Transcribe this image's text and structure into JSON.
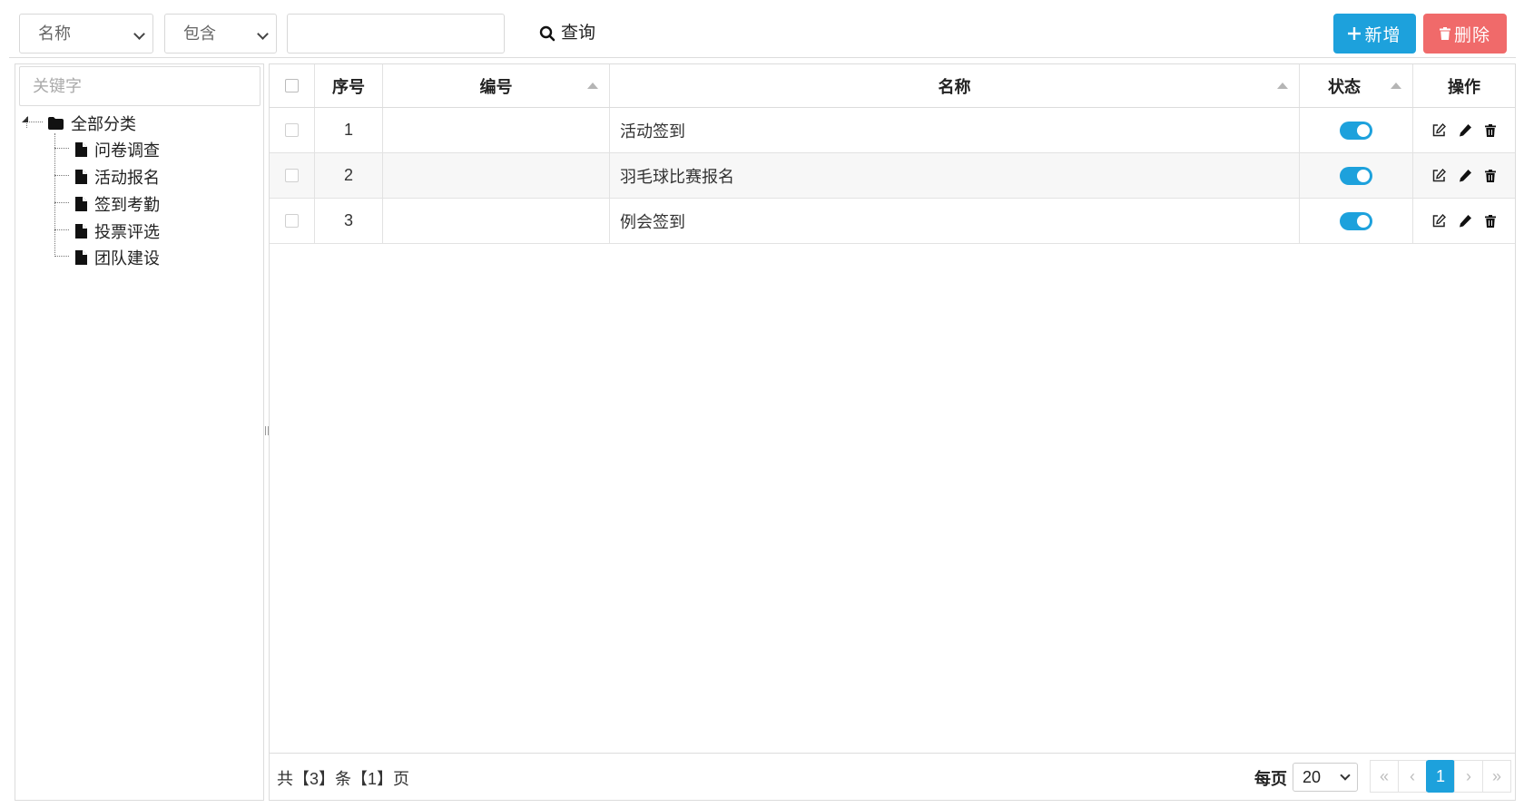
{
  "toolbar": {
    "field_select": "名称",
    "operator_select": "包含",
    "search_value": "",
    "query_label": "查询",
    "add_label": "新增",
    "delete_label": "删除",
    "colors": {
      "add": "#1da1dc",
      "delete": "#f06a6a"
    }
  },
  "tree": {
    "search_placeholder": "关键字",
    "root": "全部分类",
    "children": [
      "问卷调查",
      "活动报名",
      "签到考勤",
      "投票评选",
      "团队建设"
    ]
  },
  "grid": {
    "columns": {
      "index": "序号",
      "code": "编号",
      "name": "名称",
      "status": "状态",
      "actions": "操作"
    },
    "rows": [
      {
        "index": "1",
        "code": "",
        "name": "活动签到",
        "status": true
      },
      {
        "index": "2",
        "code": "",
        "name": "羽毛球比赛报名",
        "status": true
      },
      {
        "index": "3",
        "code": "",
        "name": "例会签到",
        "status": true
      }
    ]
  },
  "footer": {
    "summary": "共【3】条【1】页",
    "per_page_label": "每页",
    "per_page_value": "20",
    "current_page": "1",
    "pager": {
      "first": "«",
      "prev": "‹",
      "next": "›",
      "last": "»"
    }
  }
}
